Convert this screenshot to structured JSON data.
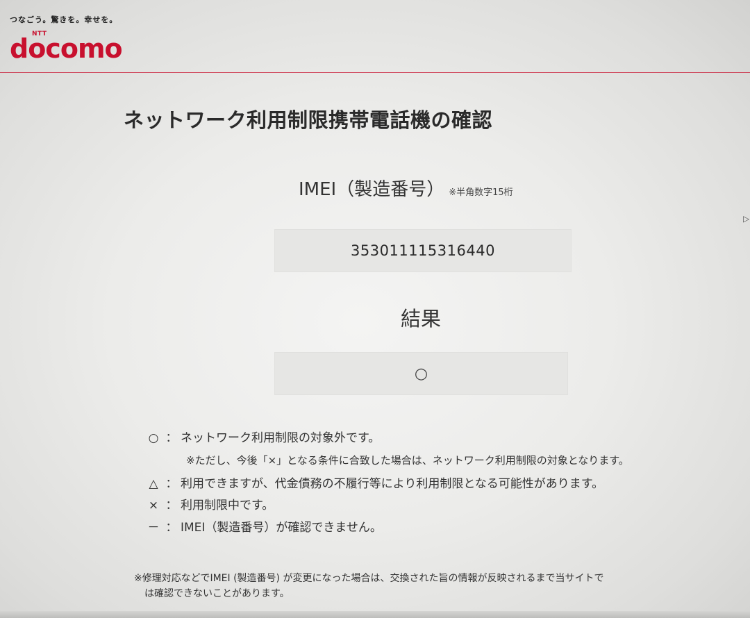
{
  "header": {
    "tagline": "つなごう。驚きを。幸せを。",
    "logo_ntt": "NTT",
    "logo_text": "docomo",
    "brand_color": "#c8102e"
  },
  "main": {
    "title": "ネットワーク利用制限携帯電話機の確認",
    "imei_label": "IMEI（製造番号）",
    "imei_note": "※半角数字15桁",
    "imei_value": "353011115316440",
    "result_label": "結果",
    "result_value": "○"
  },
  "legend": {
    "items": [
      {
        "symbol": "○",
        "colon": "：",
        "text": "ネットワーク利用制限の対象外です。"
      },
      {
        "symbol": "△",
        "colon": "：",
        "text": "利用できますが、代金債務の不履行等により利用制限となる可能性があります。"
      },
      {
        "symbol": "×",
        "colon": "：",
        "text": "利用制限中です。"
      },
      {
        "symbol": "－",
        "colon": "：",
        "text": "IMEI（製造番号）が確認できません。"
      }
    ],
    "circle_subnote": "※ただし、今後「×」となる条件に合致した場合は、ネットワーク利用制限の対象となります。"
  },
  "footnote": {
    "line1": "※修理対応などでIMEI (製造番号) が変更になった場合は、交換された旨の情報が反映されるまで当サイトで",
    "line2": "は確認できないことがあります。"
  },
  "edge_mark": "▷"
}
